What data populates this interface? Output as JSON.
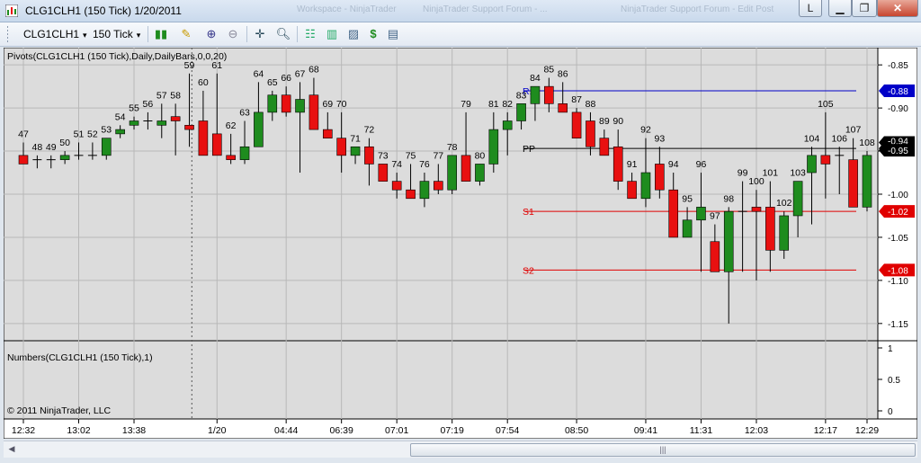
{
  "window": {
    "title": "CLG1CLH1 (150 Tick)  1/20/2011",
    "ghost_tabs": [
      "NinjaTrader Support Forum - ...",
      "Workspace - NinjaTrader",
      "NinjaTrader Support Forum - Edit Post"
    ],
    "help_label": "L"
  },
  "toolbar": {
    "instrument": "CLG1CLH1",
    "interval": "150 Tick",
    "icons": [
      "bar-style-icon",
      "drawing-pencil-icon",
      "zoom-in-icon",
      "zoom-out-icon",
      "crosshair-icon",
      "search-icon",
      "strategies-icon",
      "indicators-icon",
      "chart-properties-icon",
      "dollar-icon",
      "data-box-icon"
    ]
  },
  "chart": {
    "pivots_label": "Pivots(CLG1CLH1 (150 Tick),Daily,DailyBars,0,0,20)",
    "numbers_label": "Numbers(CLG1CLH1 (150 Tick),1)",
    "copyright": "© 2011 NinjaTrader, LLC",
    "price_ticks": [
      "-0.85",
      "-0.90",
      "-0.95",
      "-1.00",
      "-1.05",
      "-1.10",
      "-1.15"
    ],
    "lower_ticks": [
      "1",
      "0.5",
      "0"
    ],
    "time_ticks": [
      "12:32",
      "13:02",
      "13:38",
      "1/20",
      "04:44",
      "06:39",
      "07:01",
      "07:19",
      "07:54",
      "08:50",
      "09:41",
      "11:31",
      "12:03",
      "12:17",
      "12:29"
    ],
    "pivot_lines": [
      {
        "name": "R1",
        "value": -0.88,
        "label": "-0.88",
        "color": "#0000c8"
      },
      {
        "name": "PP",
        "value": -0.947,
        "label": "-0.95",
        "color": "#000000"
      },
      {
        "name": "S1",
        "value": -1.02,
        "label": "-1.02",
        "color": "#e00000"
      },
      {
        "name": "S2",
        "value": -1.088,
        "label": "-1.08",
        "color": "#e00000"
      }
    ],
    "last_price_label": "-0.94",
    "colors": {
      "up": "#1e8c1e",
      "down": "#e81010",
      "background": "#dcdcdc"
    }
  },
  "chart_data": {
    "type": "candlestick",
    "ylim": [
      -1.17,
      -0.83
    ],
    "bars": [
      {
        "n": "47",
        "o": -0.955,
        "h": -0.94,
        "l": -0.965,
        "c": -0.965
      },
      {
        "n": "48",
        "o": -0.96,
        "h": -0.955,
        "l": -0.97,
        "c": -0.96
      },
      {
        "n": "49",
        "o": -0.96,
        "h": -0.955,
        "l": -0.97,
        "c": -0.96
      },
      {
        "n": "50",
        "o": -0.96,
        "h": -0.95,
        "l": -0.965,
        "c": -0.955
      },
      {
        "n": "51",
        "o": -0.955,
        "h": -0.94,
        "l": -0.96,
        "c": -0.955
      },
      {
        "n": "52",
        "o": -0.955,
        "h": -0.94,
        "l": -0.96,
        "c": -0.955
      },
      {
        "n": "53",
        "o": -0.955,
        "h": -0.935,
        "l": -0.96,
        "c": -0.935
      },
      {
        "n": "54",
        "o": -0.93,
        "h": -0.92,
        "l": -0.935,
        "c": -0.925
      },
      {
        "n": "55",
        "o": -0.92,
        "h": -0.91,
        "l": -0.925,
        "c": -0.915
      },
      {
        "n": "56",
        "o": -0.915,
        "h": -0.905,
        "l": -0.925,
        "c": -0.915
      },
      {
        "n": "57",
        "o": -0.92,
        "h": -0.895,
        "l": -0.935,
        "c": -0.915
      },
      {
        "n": "58",
        "o": -0.91,
        "h": -0.895,
        "l": -0.955,
        "c": -0.915
      },
      {
        "n": "59",
        "o": -0.92,
        "h": -0.86,
        "l": -0.945,
        "c": -0.925
      },
      {
        "n": "60",
        "o": -0.915,
        "h": -0.88,
        "l": -0.955,
        "c": -0.955
      },
      {
        "n": "61",
        "o": -0.93,
        "h": -0.86,
        "l": -0.955,
        "c": -0.955
      },
      {
        "n": "62",
        "o": -0.955,
        "h": -0.93,
        "l": -0.965,
        "c": -0.96
      },
      {
        "n": "63",
        "o": -0.96,
        "h": -0.915,
        "l": -0.965,
        "c": -0.945
      },
      {
        "n": "64",
        "o": -0.945,
        "h": -0.87,
        "l": -0.945,
        "c": -0.905
      },
      {
        "n": "65",
        "o": -0.905,
        "h": -0.88,
        "l": -0.915,
        "c": -0.885
      },
      {
        "n": "66",
        "o": -0.885,
        "h": -0.875,
        "l": -0.91,
        "c": -0.905
      },
      {
        "n": "67",
        "o": -0.905,
        "h": -0.87,
        "l": -0.975,
        "c": -0.89
      },
      {
        "n": "68",
        "o": -0.885,
        "h": -0.865,
        "l": -0.925,
        "c": -0.925
      },
      {
        "n": "69",
        "o": -0.925,
        "h": -0.905,
        "l": -0.935,
        "c": -0.935
      },
      {
        "n": "70",
        "o": -0.935,
        "h": -0.905,
        "l": -0.975,
        "c": -0.955
      },
      {
        "n": "71",
        "o": -0.955,
        "h": -0.945,
        "l": -0.965,
        "c": -0.945
      },
      {
        "n": "72",
        "o": -0.945,
        "h": -0.935,
        "l": -0.99,
        "c": -0.965
      },
      {
        "n": "73",
        "o": -0.965,
        "h": -0.965,
        "l": -0.985,
        "c": -0.985
      },
      {
        "n": "74",
        "o": -0.985,
        "h": -0.975,
        "l": -1.005,
        "c": -0.995
      },
      {
        "n": "75",
        "o": -0.995,
        "h": -0.965,
        "l": -1.005,
        "c": -1.005
      },
      {
        "n": "76",
        "o": -1.005,
        "h": -0.975,
        "l": -1.015,
        "c": -0.985
      },
      {
        "n": "77",
        "o": -0.985,
        "h": -0.965,
        "l": -1.0,
        "c": -0.995
      },
      {
        "n": "78",
        "o": -0.995,
        "h": -0.955,
        "l": -1.0,
        "c": -0.955
      },
      {
        "n": "79",
        "o": -0.955,
        "h": -0.905,
        "l": -0.985,
        "c": -0.985
      },
      {
        "n": "80",
        "o": -0.985,
        "h": -0.965,
        "l": -0.99,
        "c": -0.965
      },
      {
        "n": "81",
        "o": -0.965,
        "h": -0.905,
        "l": -0.975,
        "c": -0.925
      },
      {
        "n": "82",
        "o": -0.925,
        "h": -0.905,
        "l": -0.955,
        "c": -0.915
      },
      {
        "n": "83",
        "o": -0.915,
        "h": -0.895,
        "l": -0.925,
        "c": -0.895
      },
      {
        "n": "84",
        "o": -0.895,
        "h": -0.875,
        "l": -0.915,
        "c": -0.875
      },
      {
        "n": "85",
        "o": -0.875,
        "h": -0.865,
        "l": -0.905,
        "c": -0.895
      },
      {
        "n": "86",
        "o": -0.895,
        "h": -0.87,
        "l": -0.905,
        "c": -0.905
      },
      {
        "n": "87",
        "o": -0.905,
        "h": -0.9,
        "l": -0.935,
        "c": -0.935
      },
      {
        "n": "88",
        "o": -0.915,
        "h": -0.905,
        "l": -0.955,
        "c": -0.945
      },
      {
        "n": "89",
        "o": -0.935,
        "h": -0.925,
        "l": -0.955,
        "c": -0.955
      },
      {
        "n": "90",
        "o": -0.945,
        "h": -0.925,
        "l": -0.995,
        "c": -0.985
      },
      {
        "n": "91",
        "o": -0.985,
        "h": -0.975,
        "l": -1.005,
        "c": -1.005
      },
      {
        "n": "92",
        "o": -1.005,
        "h": -0.935,
        "l": -1.015,
        "c": -0.975
      },
      {
        "n": "93",
        "o": -0.965,
        "h": -0.945,
        "l": -1.005,
        "c": -0.995
      },
      {
        "n": "94",
        "o": -0.995,
        "h": -0.975,
        "l": -1.05,
        "c": -1.05
      },
      {
        "n": "95",
        "o": -1.05,
        "h": -1.015,
        "l": -1.05,
        "c": -1.03
      },
      {
        "n": "96",
        "o": -1.03,
        "h": -0.975,
        "l": -1.09,
        "c": -1.015
      },
      {
        "n": "97",
        "o": -1.055,
        "h": -1.035,
        "l": -1.09,
        "c": -1.09
      },
      {
        "n": "98",
        "o": -1.09,
        "h": -1.015,
        "l": -1.15,
        "c": -1.02
      },
      {
        "n": "99",
        "o": -1.02,
        "h": -0.985,
        "l": -1.09,
        "c": -1.02
      },
      {
        "n": "100",
        "o": -1.015,
        "h": -0.995,
        "l": -1.1,
        "c": -1.02
      },
      {
        "n": "101",
        "o": -1.015,
        "h": -0.985,
        "l": -1.09,
        "c": -1.065
      },
      {
        "n": "102",
        "o": -1.065,
        "h": -1.02,
        "l": -1.075,
        "c": -1.025
      },
      {
        "n": "103",
        "o": -1.025,
        "h": -0.985,
        "l": -1.05,
        "c": -0.985
      },
      {
        "n": "104",
        "o": -0.975,
        "h": -0.945,
        "l": -1.035,
        "c": -0.955
      },
      {
        "n": "105",
        "o": -0.955,
        "h": -0.905,
        "l": -1.005,
        "c": -0.965
      },
      {
        "n": "106",
        "o": -0.955,
        "h": -0.945,
        "l": -1.0,
        "c": -0.955
      },
      {
        "n": "107",
        "o": -0.96,
        "h": -0.935,
        "l": -1.01,
        "c": -1.015
      },
      {
        "n": "108",
        "o": -1.015,
        "h": -0.95,
        "l": -1.02,
        "c": -0.955
      }
    ]
  }
}
